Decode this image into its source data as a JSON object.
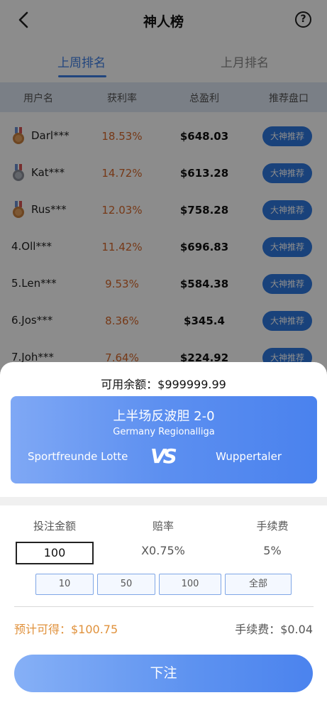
{
  "header": {
    "title": "神人榜",
    "help_icon": "?"
  },
  "tabs": [
    {
      "label": "上周排名",
      "active": true
    },
    {
      "label": "上月排名",
      "active": false
    }
  ],
  "columns": [
    "用户名",
    "获利率",
    "总盈利",
    "推荐盘口"
  ],
  "rows": [
    {
      "medal": "bronze-medal-icon",
      "user": "Darl***",
      "rate": "18.53%",
      "profit": "$648.03",
      "button": "大神推荐"
    },
    {
      "medal": "silver-medal-icon",
      "user": "Kat***",
      "rate": "14.72%",
      "profit": "$613.28",
      "button": "大神推荐"
    },
    {
      "medal": "bronze-medal-icon",
      "user": "Rus***",
      "rate": "12.03%",
      "profit": "$758.28",
      "button": "大神推荐"
    },
    {
      "user": "4.Oll***",
      "rate": "11.42%",
      "profit": "$696.83",
      "button": "大神推荐"
    },
    {
      "user": "5.Len***",
      "rate": "9.53%",
      "profit": "$584.38",
      "button": "大神推荐"
    },
    {
      "user": "6.Jos***",
      "rate": "8.36%",
      "profit": "$345.4",
      "button": "大神推荐"
    },
    {
      "user": "7.Joh***",
      "rate": "7.64%",
      "profit": "$224.92",
      "button": "大神推荐"
    }
  ],
  "sheet": {
    "balance": "可用余额：$999999.99",
    "match": {
      "title": "上半场反波胆 2-0",
      "league": "Germany Regionalliga",
      "home": "Sportfreunde Lotte",
      "vs": "VS",
      "away": "Wuppertaler"
    },
    "labels": {
      "amount": "投注金额",
      "odds": "赔率",
      "fee": "手续费"
    },
    "amount_value": "100",
    "odds_value": "X0.75%",
    "fee_value": "5%",
    "chips": [
      "10",
      "50",
      "100",
      "全部"
    ],
    "expected": "预计可得：$100.75",
    "fee_summary": "手续费：$0.04",
    "submit": "下注"
  },
  "colors": {
    "accent": "#3d7fe6",
    "rate": "#d8682b",
    "expected": "#e0913b"
  }
}
